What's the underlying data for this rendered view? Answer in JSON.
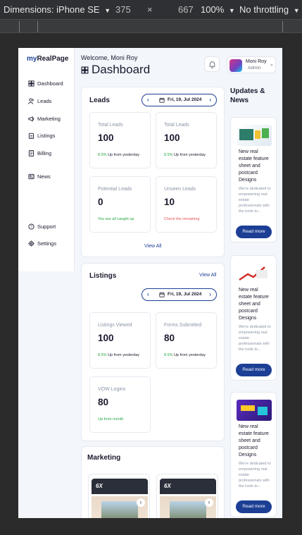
{
  "devtools": {
    "device": "Dimensions: iPhone SE",
    "width": "375",
    "times": "×",
    "height": "667",
    "zoom": "100%",
    "throttle": "No throttling",
    "caret": "▼"
  },
  "sidebar": {
    "logo_prefix": "my",
    "logo_suffix": "RealPage",
    "items": [
      {
        "label": "Dashboard",
        "icon": "grid-icon"
      },
      {
        "label": "Leads",
        "icon": "users-icon"
      },
      {
        "label": "Marketing",
        "icon": "megaphone-icon"
      },
      {
        "label": "Listings",
        "icon": "clipboard-icon"
      },
      {
        "label": "Billing",
        "icon": "document-icon"
      },
      {
        "label": "News",
        "icon": "newspaper-icon"
      },
      {
        "label": "Support",
        "icon": "help-icon"
      },
      {
        "label": "Settings",
        "icon": "gear-icon"
      }
    ]
  },
  "header": {
    "welcome": "Welcome, Moni Roy",
    "title": "Dashboard",
    "user_name": "Moni Roy",
    "user_role": "Admin"
  },
  "leads": {
    "title": "Leads",
    "date": "Fri, 19, Jul 2024",
    "stats": [
      {
        "label": "Total Leads",
        "value": "100",
        "pct": "8.5%",
        "note": "Up from yesterday"
      },
      {
        "label": "Total Leads",
        "value": "100",
        "pct": "8.5%",
        "note": "Up from yesterday"
      },
      {
        "label": "Potential Leads",
        "value": "0",
        "note": "You are all caught up"
      },
      {
        "label": "Unseen Leads",
        "value": "10",
        "note": "Check the remaining"
      }
    ],
    "view_all": "View All"
  },
  "listings": {
    "title": "Listings",
    "view_all": "View All",
    "date": "Fri, 19, Jul 2024",
    "stats": [
      {
        "label": "Listings Viewed",
        "value": "100",
        "pct": "8.5%",
        "note": "Up from yesterday"
      },
      {
        "label": "Forms Submitted",
        "value": "80",
        "pct": "8.5%",
        "note": "Up from yesterday"
      },
      {
        "label": "VOW Logins",
        "value": "80",
        "note": "Up from month"
      }
    ]
  },
  "marketing": {
    "title": "Marketing",
    "tag": "6X"
  },
  "updates": {
    "title": "Updates & News",
    "items": [
      {
        "headline": "New real estate feature sheet and postcard Designs",
        "body": "We're dedicated to empowering real estate professionals with the tools to...",
        "button": "Read more"
      },
      {
        "headline": "New real estate feature sheet and postcard Designs",
        "body": "We're dedicated to empowering real estate professionals with the tools to...",
        "button": "Read more"
      },
      {
        "headline": "New real estate feature sheet and postcard Designs",
        "body": "We're dedicated to empowering real estate professionals with the tools to...",
        "button": "Read more"
      }
    ]
  },
  "colors": {
    "brand": "#1c3f95",
    "positive": "#28a745",
    "negative": "#e55353",
    "background": "#f3f6fb"
  }
}
